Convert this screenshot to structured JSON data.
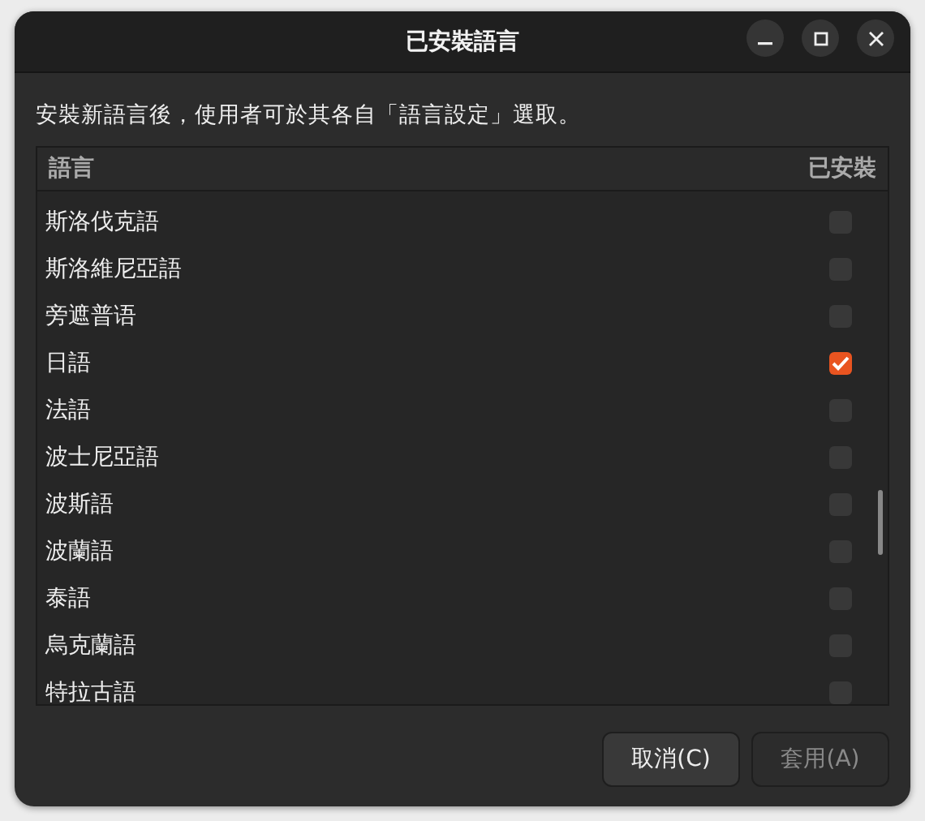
{
  "window": {
    "title": "已安裝語言"
  },
  "description": "安裝新語言後，使用者可於其各自「語言設定」選取。",
  "table": {
    "columns": [
      "語言",
      "已安裝"
    ],
    "rows": [
      {
        "name": "斯洛伐克語",
        "checked": false
      },
      {
        "name": "斯洛維尼亞語",
        "checked": false
      },
      {
        "name": "旁遮普语",
        "checked": false
      },
      {
        "name": "日語",
        "checked": true
      },
      {
        "name": "法語",
        "checked": false
      },
      {
        "name": "波士尼亞語",
        "checked": false
      },
      {
        "name": "波斯語",
        "checked": false
      },
      {
        "name": "波蘭語",
        "checked": false
      },
      {
        "name": "泰語",
        "checked": false
      },
      {
        "name": "烏克蘭語",
        "checked": false
      },
      {
        "name": "特拉古語",
        "checked": false
      }
    ]
  },
  "buttons": [
    {
      "label": "取消(C)",
      "disabled": false
    },
    {
      "label": "套用(A)",
      "disabled": true
    }
  ]
}
